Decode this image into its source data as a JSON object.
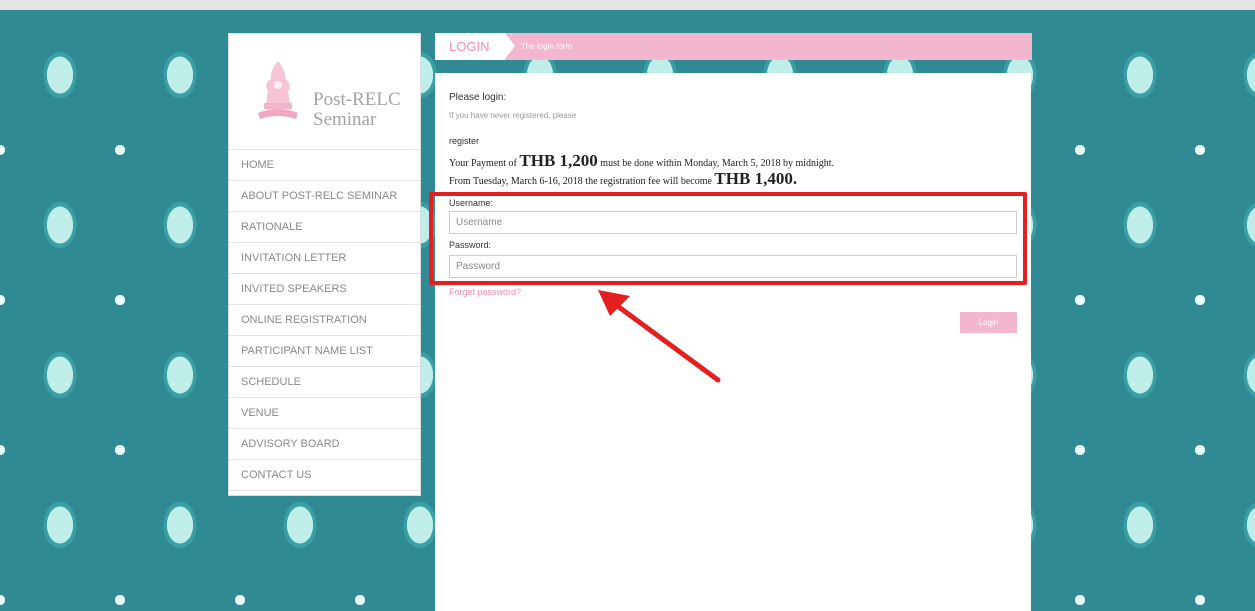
{
  "sidebar": {
    "brand_line1": "Post-RELC",
    "brand_line2": "Seminar",
    "items": [
      {
        "label": "HOME"
      },
      {
        "label": "ABOUT POST-RELC SEMINAR"
      },
      {
        "label": "RATIONALE"
      },
      {
        "label": "INVITATION LETTER"
      },
      {
        "label": "INVITED SPEAKERS"
      },
      {
        "label": "ONLINE REGISTRATION"
      },
      {
        "label": "PARTICIPANT NAME LIST"
      },
      {
        "label": "SCHEDULE"
      },
      {
        "label": "VENUE"
      },
      {
        "label": "ADVISORY BOARD"
      },
      {
        "label": "CONTACT US"
      }
    ]
  },
  "header": {
    "tab": "LOGIN",
    "crumb": "The login form"
  },
  "form": {
    "please_login": "Please login:",
    "never_registered": "If you have never registered, please",
    "register": "register",
    "payment1_pre": "Your Payment of ",
    "payment1_amount": "THB 1,200",
    "payment1_post": " must be done within Monday, March 5, 2018 by midnight.",
    "payment2_pre": "From Tuesday, March 6-16, 2018 the registration fee will become ",
    "payment2_amount": "THB 1,400.",
    "username_label": "Username:",
    "username_placeholder": "Username",
    "username_value": "",
    "password_label": "Password:",
    "password_placeholder": "Password",
    "password_value": "",
    "forget_password": "Forget password?",
    "login_button": "Login"
  },
  "colors": {
    "accent_pink": "#f3b6cf",
    "link_pink": "#f08db8",
    "annotation_red": "#e41f1f",
    "background_teal": "#2f8a94"
  }
}
